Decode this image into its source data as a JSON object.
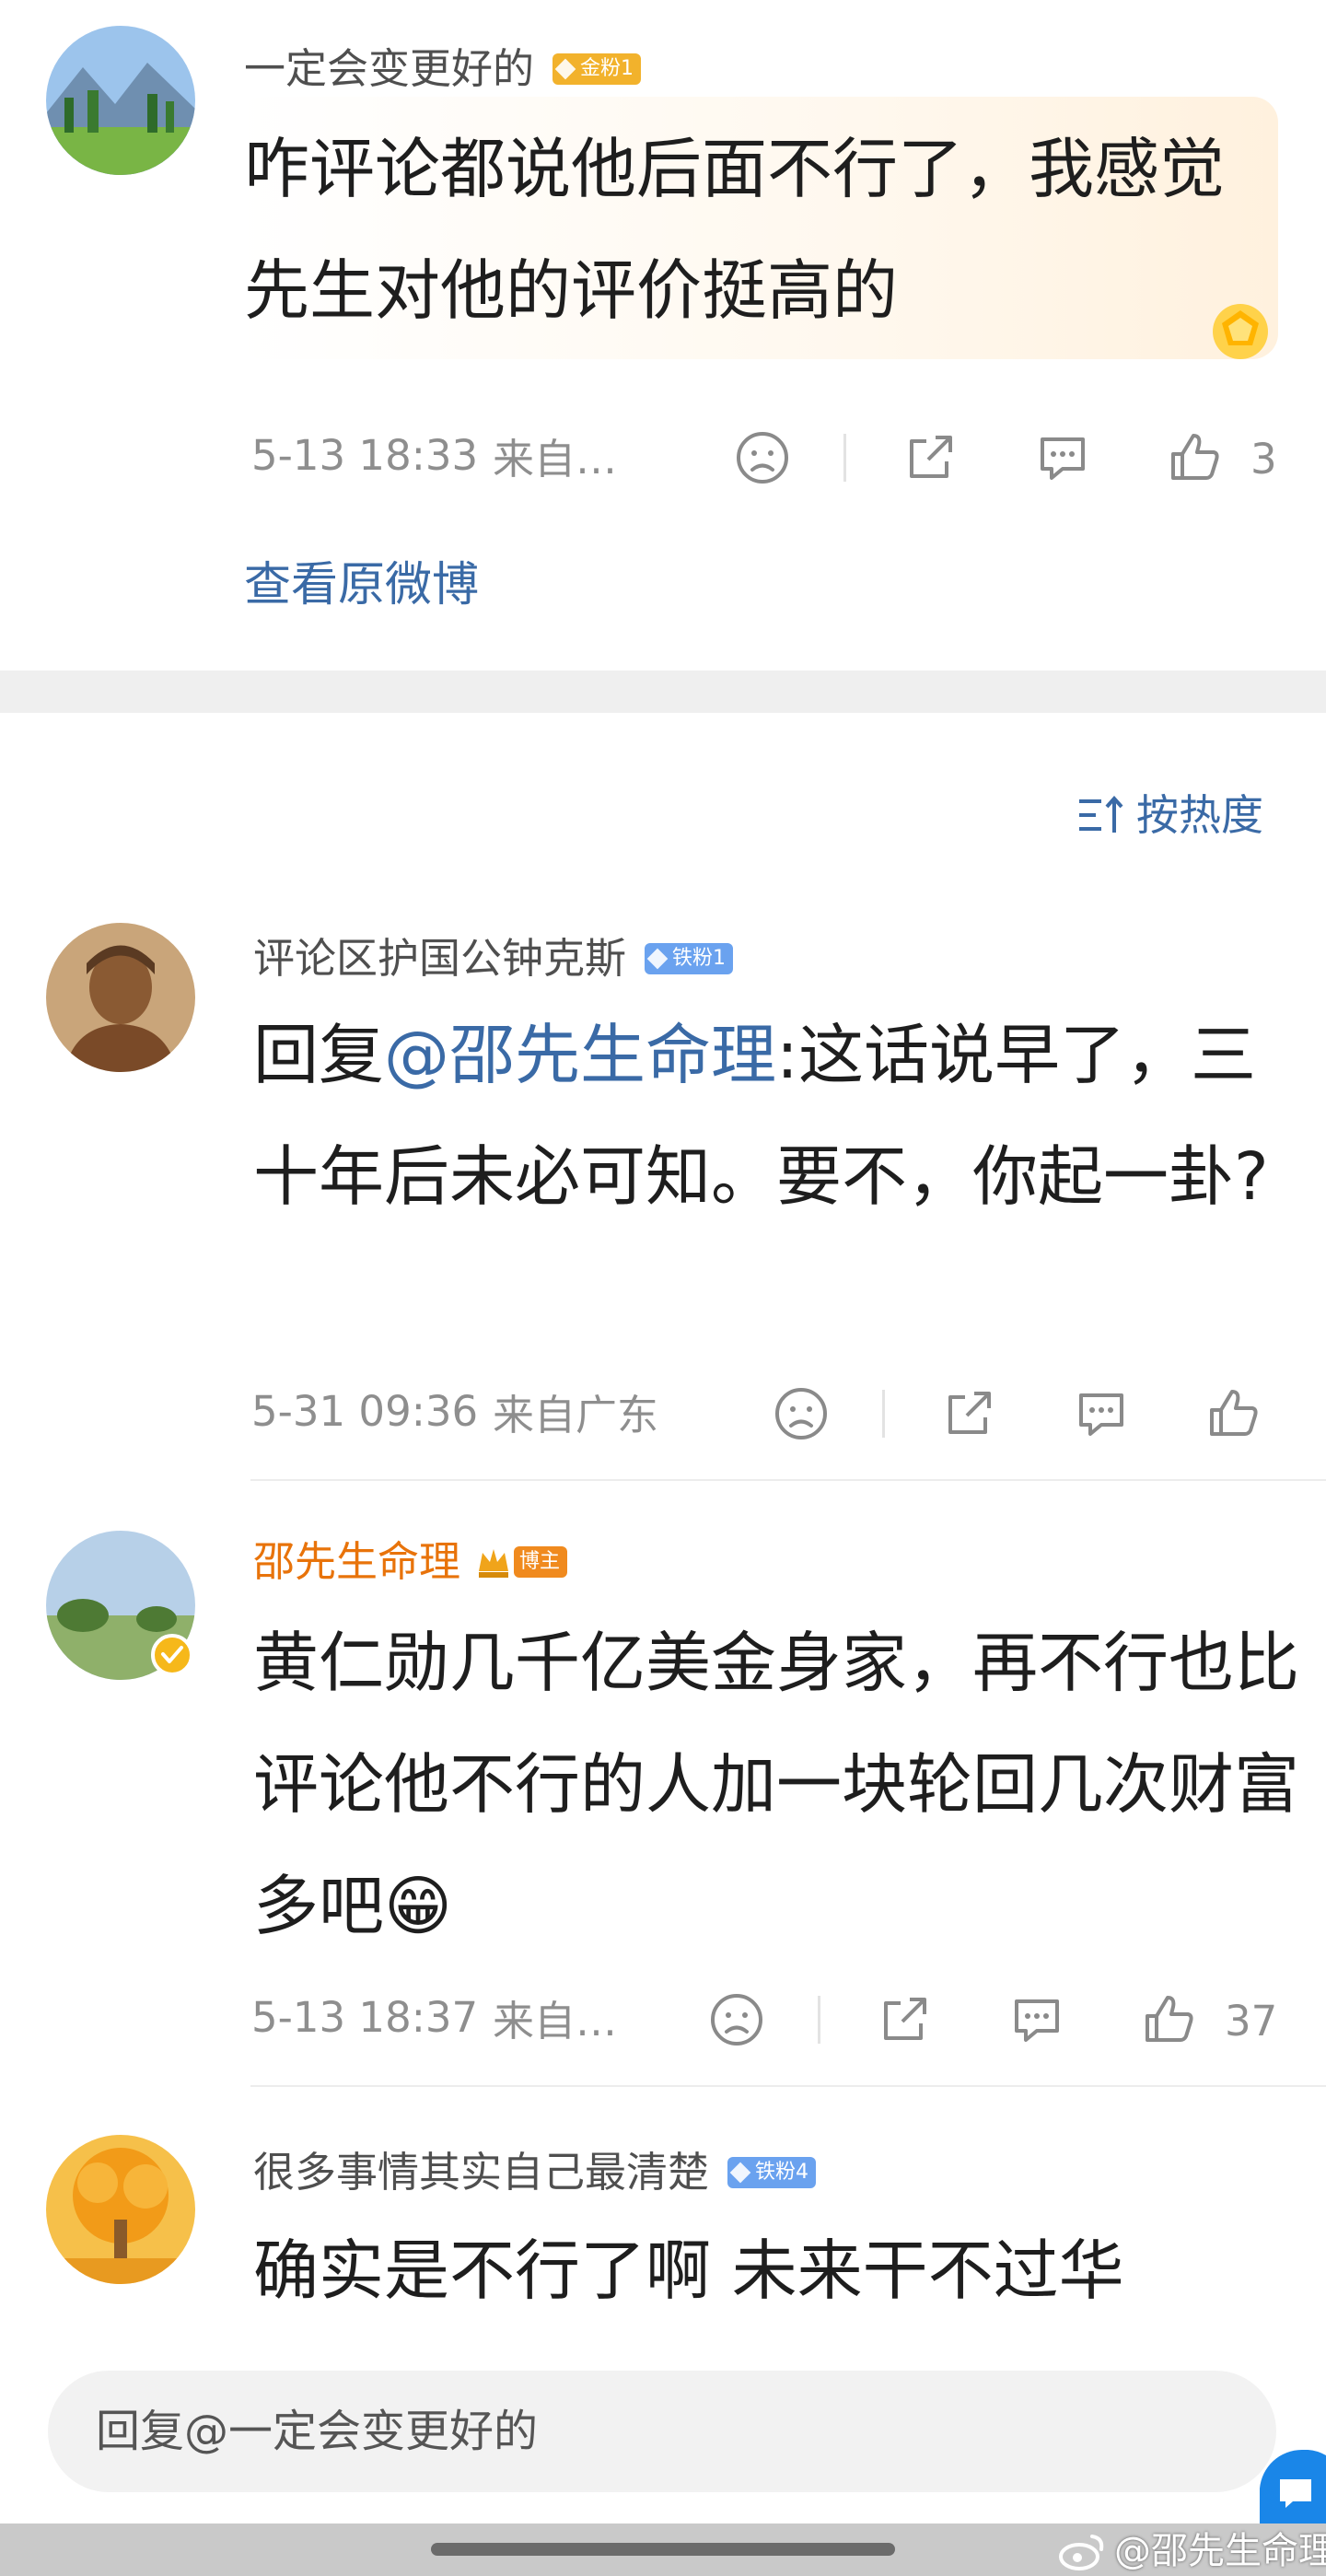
{
  "op": {
    "username": "一定会变更好的",
    "badge": "金粉1",
    "text": "咋评论都说他后面不行了，我感觉先生对他的评价挺高的",
    "time": "5-13 18:33",
    "source": "来自…",
    "like_count": "3",
    "view_original": "查看原微博"
  },
  "sort": {
    "label": "按热度"
  },
  "comments": [
    {
      "username": "评论区护国公钟克斯",
      "badge": "铁粉1",
      "reply_prefix": "回复",
      "mention": "@邵先生命理",
      "text": ":这话说早了，三十年后未必可知。要不，你起一卦?",
      "time": "5-31 09:36",
      "source": "来自广东",
      "like_count": ""
    },
    {
      "username": "邵先生命理",
      "badge": "博主",
      "text": "黄仁勋几千亿美金身家，再不行也比评论他不行的人加一块轮回几次财富多吧😁",
      "time": "5-13 18:37",
      "source": "来自…",
      "like_count": "37"
    },
    {
      "username": "很多事情其实自己最清楚",
      "badge": "铁粉4",
      "text": "确实是不行了啊 未来干不过华"
    }
  ],
  "reply_input": {
    "placeholder": "回复@一定会变更好的"
  },
  "watermark": "@邵先生命理",
  "colors": {
    "gold_badge": "#f2b22c",
    "iron_badge": "#6aa2ef",
    "blogger_badge": "#f08a1e",
    "link": "#3a6aa6",
    "meta": "#8e8e8e",
    "divider": "#eeeeee"
  },
  "icons": [
    "sad-face-icon",
    "share-icon",
    "comment-icon",
    "like-thumb-icon",
    "sort-icon",
    "verified-icon",
    "crown-icon",
    "weibo-logo-icon",
    "chat-bubble-icon"
  ]
}
